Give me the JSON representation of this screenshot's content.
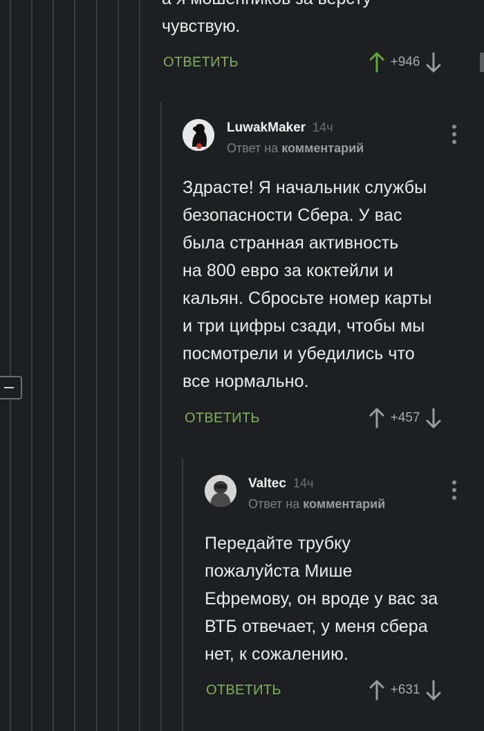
{
  "top_comment": {
    "text_lines": [
      "а я мошенников за версту",
      "чувствую."
    ],
    "reply_label": "ОТВЕТИТЬ",
    "votes": "+946",
    "upvote_color": "#5fa83a"
  },
  "comment1": {
    "author": "LuwakMaker",
    "time": "14ч",
    "reply_to_prefix": "Ответ на",
    "reply_to_target": "комментарий",
    "text_lines": [
      "Здрасте! Я начальник службы",
      "безопасности Сбера. У вас",
      "была странная активность",
      "на 800 евро за коктейли и",
      "кальян. Сбросьте номер карты",
      "и три цифры сзади, чтобы мы",
      "посмотрели и убедились что",
      "все нормально."
    ],
    "reply_label": "ОТВЕТИТЬ",
    "votes": "+457"
  },
  "comment2": {
    "author": "Valtec",
    "time": "14ч",
    "reply_to_prefix": "Ответ на",
    "reply_to_target": "комментарий",
    "text_lines": [
      "Передайте трубку",
      "пожалуйста Мише",
      "Ефремову, он вроде у вас за",
      "ВТБ отвечает, у меня сбера",
      "нет, к сожалению."
    ],
    "reply_label": "ОТВЕТИТЬ",
    "votes": "+631"
  }
}
